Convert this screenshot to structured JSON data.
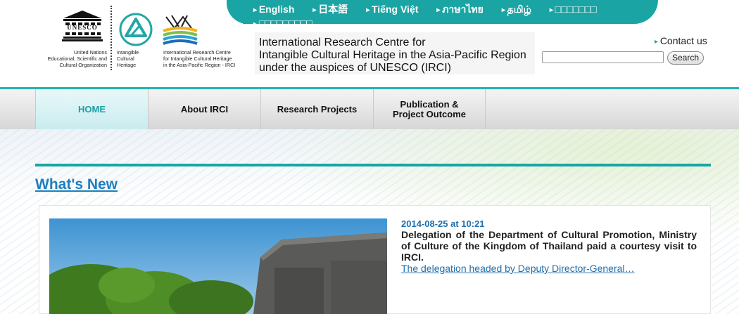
{
  "languages": [
    "English",
    "日本語",
    "Tiếng Việt",
    "ภาษาไทย",
    "தமிழ்",
    "□□□□□□□",
    "□□□□□□□□□"
  ],
  "logos": {
    "unesco_word": "UNESCO",
    "unesco_caption": [
      "United Nations",
      "Educational, Scientific and",
      "Cultural Organization"
    ],
    "ich_caption": [
      "Intangible",
      "Cultural",
      "Heritage"
    ],
    "irci_caption": [
      "International Research Centre",
      "for Intangible Cultural Heritage",
      "in the Asia-Pacific Region - IRCI"
    ]
  },
  "site_title": [
    "International Research Centre for",
    "Intangible Cultural Heritage in the Asia-Pacific Region",
    "under the auspices of UNESCO (IRCI)"
  ],
  "contact_label": "Contact us",
  "search": {
    "placeholder": "",
    "button_label": "Search"
  },
  "nav": {
    "home": "HOME",
    "about": "About IRCI",
    "research": "Research Projects",
    "publication": [
      "Publication &",
      "Project Outcome"
    ]
  },
  "whats_new": {
    "heading": "What's New",
    "date": "2014-08-25 at 10:21",
    "title": "Delegation of the Department of Cultural Promotion, Ministry of Culture of the Kingdom of Thailand paid a courtesy visit to IRCI.",
    "link": "The delegation headed by Deputy Director-General…"
  },
  "colors": {
    "teal": "#1aa5a4",
    "link_blue": "#1e6fae",
    "heading_blue": "#1c7fbf"
  }
}
